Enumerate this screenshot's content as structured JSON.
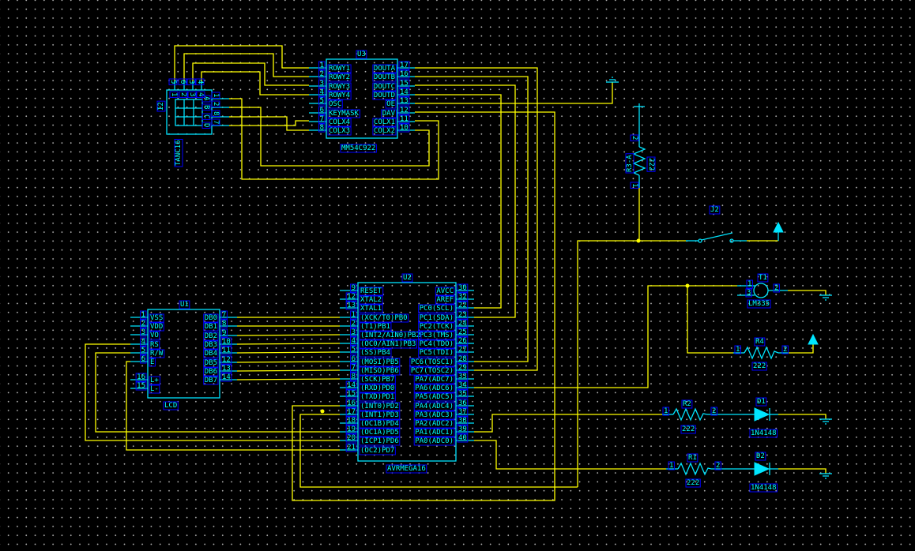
{
  "colors": {
    "background": "#000000",
    "wire": "#ffff00",
    "component": "#00e5ff",
    "label_box": "#0000ff",
    "grid_dot": "#b0b0b0",
    "junction": "#ffff00"
  },
  "components": {
    "U3": {
      "ref": "U3",
      "part": "MM54C922",
      "left_pins": [
        {
          "num": "1",
          "name": "ROWY1"
        },
        {
          "num": "2",
          "name": "ROWY2"
        },
        {
          "num": "3",
          "name": "ROWY3"
        },
        {
          "num": "4",
          "name": "ROWY4"
        },
        {
          "num": "5",
          "name": "OSC"
        },
        {
          "num": "6",
          "name": "KEYMASK"
        },
        {
          "num": "7",
          "name": "COLX4"
        },
        {
          "num": "8",
          "name": "COLX3"
        }
      ],
      "right_pins": [
        {
          "num": "17",
          "name": "DOUTA"
        },
        {
          "num": "16",
          "name": "DOUTB"
        },
        {
          "num": "15",
          "name": "DOUTC"
        },
        {
          "num": "14",
          "name": "DOUTD"
        },
        {
          "num": "13",
          "name": "OE",
          "overline": true
        },
        {
          "num": "12",
          "name": "DAV"
        },
        {
          "num": "11",
          "name": "COLX1"
        },
        {
          "num": "10",
          "name": "COLX2"
        }
      ]
    },
    "U2": {
      "ref": "U2",
      "part": "AVRMEGA16",
      "left_pins": [
        {
          "num": "9",
          "name": "RESET",
          "overline": true
        },
        {
          "num": "12",
          "name": "XTAL2"
        },
        {
          "num": "13",
          "name": "XTAL1"
        },
        {
          "num": "1",
          "name": "(XCK/T0)PB0"
        },
        {
          "num": "2",
          "name": "(T1)PB1"
        },
        {
          "num": "3",
          "name": "(INT2/AIN0)PB2"
        },
        {
          "num": "4",
          "name": "(OC0/AIN1)PB3"
        },
        {
          "num": "5",
          "name": "(SS)PB4"
        },
        {
          "num": "6",
          "name": "(MOSI)PB5"
        },
        {
          "num": "7",
          "name": "(MISO)PB6"
        },
        {
          "num": "8",
          "name": "(SCK)PB7"
        },
        {
          "num": "14",
          "name": "(RXD)PD0"
        },
        {
          "num": "15",
          "name": "(TXD)PD1"
        },
        {
          "num": "16",
          "name": "(INT0)PD2"
        },
        {
          "num": "17",
          "name": "(INT1)PD3"
        },
        {
          "num": "18",
          "name": "(OC1B)PD4"
        },
        {
          "num": "19",
          "name": "(OC1A)PD5"
        },
        {
          "num": "20",
          "name": "(ICP1)PD6"
        },
        {
          "num": "21",
          "name": "(OC2)PD7"
        }
      ],
      "right_pins": [
        {
          "num": "30",
          "name": "AVCC"
        },
        {
          "num": "32",
          "name": "AREF"
        },
        {
          "num": "22",
          "name": "PC0(SCL)"
        },
        {
          "num": "23",
          "name": "PC1(SDA)"
        },
        {
          "num": "24",
          "name": "PC2(TCK)"
        },
        {
          "num": "25",
          "name": "PC3(TMS)"
        },
        {
          "num": "26",
          "name": "PC4(TDO)"
        },
        {
          "num": "27",
          "name": "PC5(TDI)"
        },
        {
          "num": "28",
          "name": "PC6(TOSC1)"
        },
        {
          "num": "29",
          "name": "PC7(TOSC2)"
        },
        {
          "num": "33",
          "name": "PA7(ADC7)"
        },
        {
          "num": "34",
          "name": "PA6(ADC6)"
        },
        {
          "num": "35",
          "name": "PA5(ADC5)"
        },
        {
          "num": "36",
          "name": "PA4(ADC4)"
        },
        {
          "num": "37",
          "name": "PA3(ADC3)"
        },
        {
          "num": "38",
          "name": "PA2(ADC2)"
        },
        {
          "num": "39",
          "name": "PA1(ADC1)"
        },
        {
          "num": "40",
          "name": "PA0(ADC0)"
        }
      ]
    },
    "U1": {
      "ref": "U1",
      "part": "LCD",
      "left_pins": [
        {
          "num": "1",
          "name": "VSS"
        },
        {
          "num": "2",
          "name": "VDD"
        },
        {
          "num": "3",
          "name": "VO"
        },
        {
          "num": "4",
          "name": "RS"
        },
        {
          "num": "5",
          "name": "R/W"
        },
        {
          "num": "6",
          "name": "E"
        },
        {
          "num": "16",
          "name": "L+"
        },
        {
          "num": "15",
          "name": "L-"
        }
      ],
      "right_pins": [
        {
          "num": "7",
          "name": "DB0"
        },
        {
          "num": "8",
          "name": "DB1"
        },
        {
          "num": "9",
          "name": "DB2"
        },
        {
          "num": "10",
          "name": "DB3"
        },
        {
          "num": "11",
          "name": "DB4"
        },
        {
          "num": "12",
          "name": "DB5"
        },
        {
          "num": "13",
          "name": "DB6"
        },
        {
          "num": "14",
          "name": "DB7"
        }
      ]
    },
    "keypad": {
      "ref": "I2",
      "part": "TANC16",
      "top_pins": [
        "5",
        "6",
        "3",
        "4"
      ],
      "inner_top": [
        "1",
        "2",
        "3",
        "4"
      ],
      "inner_right": [
        "A",
        "B",
        "C",
        "D"
      ],
      "right_pins": [
        "1",
        "2",
        "8",
        "7"
      ]
    },
    "R3": {
      "ref": "R3-A",
      "value": "222",
      "pin1": "1",
      "pin2": "2"
    },
    "J2": {
      "ref": "J2"
    },
    "T1": {
      "ref": "T1",
      "part": "LM335",
      "pin1": "1",
      "pin3": "3",
      "pin2": "2"
    },
    "R4": {
      "ref": "R4",
      "value": "222",
      "pin1": "1",
      "pin2": "2"
    },
    "R2": {
      "ref": "R2",
      "value": "222",
      "pin1": "1",
      "pin2": "2"
    },
    "R1": {
      "ref": "R1",
      "value": "222",
      "pin1": "1",
      "pin2": "2"
    },
    "D1": {
      "ref": "D1",
      "part": "1N4148"
    },
    "D2": {
      "ref": "D2",
      "part": "1N4148"
    }
  }
}
